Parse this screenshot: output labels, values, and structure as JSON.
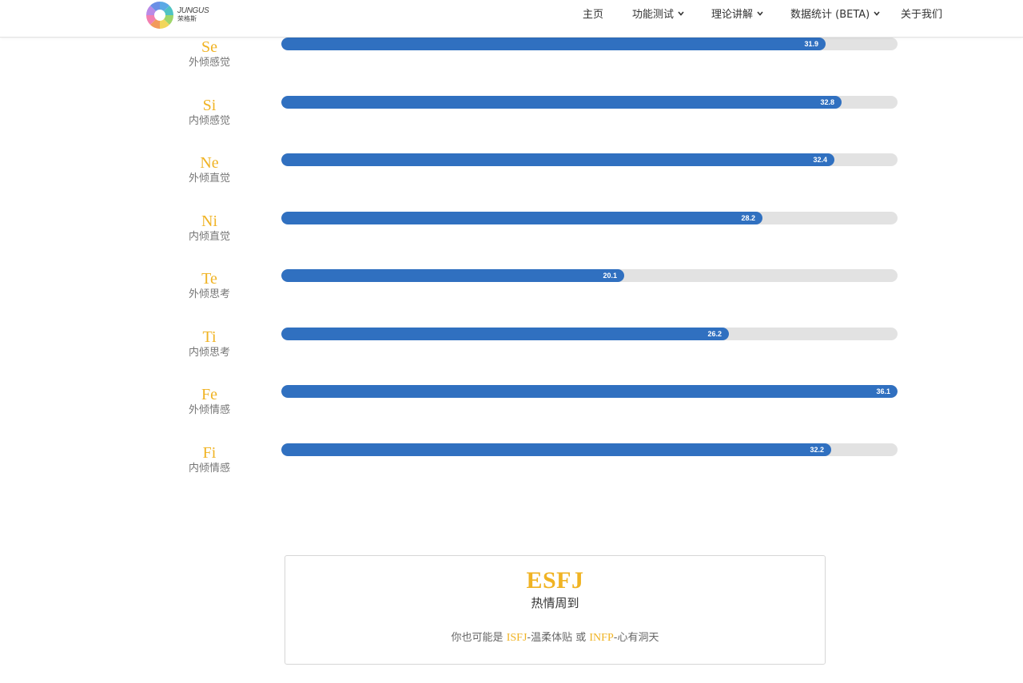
{
  "header": {
    "logo": {
      "text_en": "JUNGUS",
      "text_cn": "荣格斯",
      "colors": [
        "#5aa9e6",
        "#4fc3c3",
        "#9fd66a",
        "#f2d65a",
        "#f29a5a",
        "#f27fb0",
        "#b98ae6",
        "#6a8fe6"
      ]
    },
    "nav": [
      {
        "label": "主页",
        "dropdown": false
      },
      {
        "label": "功能测试",
        "dropdown": true
      },
      {
        "label": "理论讲解",
        "dropdown": true
      },
      {
        "label": "数据统计 (BETA)",
        "dropdown": true
      },
      {
        "label": "关于我们",
        "dropdown": false
      }
    ]
  },
  "functions": {
    "max": 36.1,
    "colors": {
      "code": "#f0b323",
      "fill": "#3070c0",
      "track": "#e2e2e2"
    },
    "items": [
      {
        "code": "Se",
        "name": "外倾感觉",
        "value": 31.9
      },
      {
        "code": "Si",
        "name": "内倾感觉",
        "value": 32.8
      },
      {
        "code": "Ne",
        "name": "外倾直觉",
        "value": 32.4
      },
      {
        "code": "Ni",
        "name": "内倾直觉",
        "value": 28.2
      },
      {
        "code": "Te",
        "name": "外倾思考",
        "value": 20.1
      },
      {
        "code": "Ti",
        "name": "内倾思考",
        "value": 26.2
      },
      {
        "code": "Fe",
        "name": "外倾情感",
        "value": 36.1
      },
      {
        "code": "Fi",
        "name": "内倾情感",
        "value": 32.2
      }
    ]
  },
  "result": {
    "type": "ESFJ",
    "title": "热情周到",
    "alt_prefix": "你也可能是",
    "alt1_type": "ISFJ",
    "alt1_name": "-温柔体贴",
    "alt_or": "或",
    "alt2_type": "INFP",
    "alt2_name": "-心有洞天"
  }
}
